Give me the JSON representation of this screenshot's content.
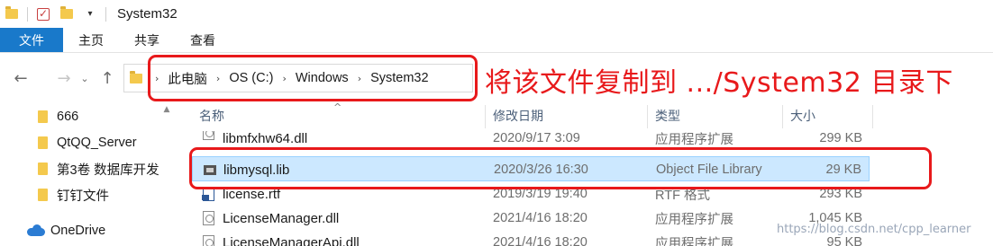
{
  "window": {
    "title": "System32"
  },
  "ribbon": {
    "tabs": [
      "文件",
      "主页",
      "共享",
      "查看"
    ]
  },
  "address": {
    "crumbs": [
      "此电脑",
      "OS (C:)",
      "Windows",
      "System32"
    ],
    "annotation": "将该文件复制到 .../System32 目录下"
  },
  "sidebar": {
    "items": [
      "666",
      "QtQQ_Server",
      "第3卷 数据库开发",
      "钉钉文件",
      "OneDrive"
    ]
  },
  "columns": {
    "name": "名称",
    "date": "修改日期",
    "type": "类型",
    "size": "大小"
  },
  "files": [
    {
      "name": "libmfxhw64.dll",
      "date": "2020/9/17 3:09",
      "type": "应用程序扩展",
      "size": "299 KB",
      "icon": "dll-file-icon"
    },
    {
      "name": "libmysql.lib",
      "date": "2020/3/26 16:30",
      "type": "Object File Library",
      "size": "29 KB",
      "icon": "lib-file-icon"
    },
    {
      "name": "license.rtf",
      "date": "2019/3/19 19:40",
      "type": "RTF 格式",
      "size": "293 KB",
      "icon": "rtf-file-icon"
    },
    {
      "name": "LicenseManager.dll",
      "date": "2021/4/16 18:20",
      "type": "应用程序扩展",
      "size": "1,045 KB",
      "icon": "dll-file-icon"
    },
    {
      "name": "LicenseManagerApi.dll",
      "date": "2021/4/16 18:20",
      "type": "应用程序扩展",
      "size": "95 KB",
      "icon": "dll-file-icon"
    }
  ],
  "watermark": "https://blog.csdn.net/cpp_learner",
  "colors": {
    "accent": "#1979ca",
    "annotation_red": "#e8191b",
    "selected_row": "#cce8ff"
  }
}
